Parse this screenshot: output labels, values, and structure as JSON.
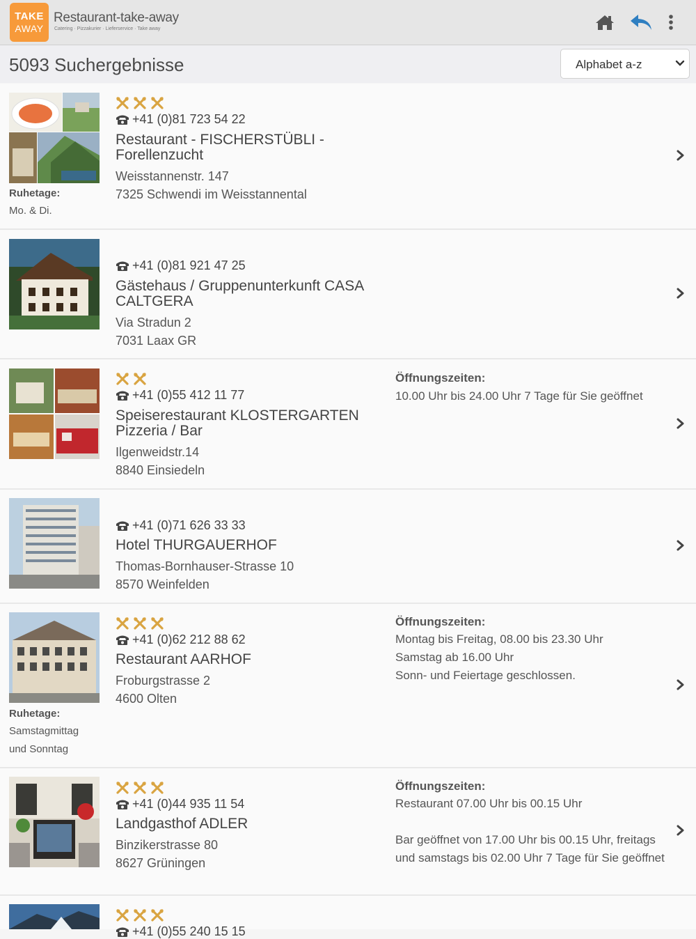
{
  "header": {
    "logo_line1": "TAKE",
    "logo_line2": "AWAY",
    "title": "Restaurant-take-away",
    "subtitle": "Catering · Pizzakurier · Lieferservice · Take away"
  },
  "search": {
    "result_count": "5093 Suchergebnisse",
    "sort_label": "Alphabet a-z"
  },
  "labels": {
    "closed_days": "Ruhetage:",
    "opening_hours": "Öffnungszeiten:"
  },
  "results": [
    {
      "stars": 3,
      "phone": "+41 (0)81 723 54 22",
      "name": "Restaurant - FISCHERSTÜBLI - Forellenzucht",
      "street": "Weisstannenstr. 147",
      "city": "7325 Schwendi im Weisstannental",
      "closed_days": "Mo. & Di."
    },
    {
      "stars": 0,
      "phone": "+41 (0)81 921 47 25",
      "name": "Gästehaus / Gruppenunterkunft CASA CALTGERA",
      "street": "Via Stradun 2",
      "city": "7031 Laax GR"
    },
    {
      "stars": 2,
      "phone": "+41 (0)55 412 11 77",
      "name": "Speiserestaurant KLOSTERGARTEN Pizzeria / Bar",
      "street": "Ilgenweidstr.14",
      "city": "8840 Einsiedeln",
      "hours": "10.00 Uhr bis 24.00 Uhr 7 Tage für Sie geöffnet"
    },
    {
      "stars": 0,
      "phone": "+41 (0)71 626 33 33",
      "name": "Hotel THURGAUERHOF",
      "street": "Thomas-Bornhauser-Strasse 10",
      "city": "8570 Weinfelden"
    },
    {
      "stars": 3,
      "phone": "+41 (0)62 212 88 62",
      "name": "Restaurant AARHOF",
      "street": "Froburgstrasse 2",
      "city": "4600 Olten",
      "closed_days_1": "Samstagmittag",
      "closed_days_2": "und Sonntag",
      "hours_1": "Montag bis Freitag, 08.00 bis 23.30 Uhr",
      "hours_2": "Samstag ab 16.00 Uhr",
      "hours_3": "Sonn- und Feiertage geschlossen."
    },
    {
      "stars": 3,
      "phone": "+41 (0)44 935 11 54",
      "name": "Landgasthof ADLER",
      "street": "Binzikerstrasse 80",
      "city": "8627 Grüningen",
      "hours_1": "Restaurant 07.00 Uhr bis 00.15 Uhr",
      "hours_2": "Bar geöffnet von 17.00 Uhr bis 00.15 Uhr, freitags und samstags bis 02.00 Uhr 7 Tage für Sie geöffnet"
    },
    {
      "stars": 3,
      "phone": "+41 (0)55 240 15 15"
    }
  ],
  "colors": {
    "accent_orange": "#f79a3a",
    "star_gold": "#d9a441",
    "back_blue": "#2f7fc1"
  }
}
